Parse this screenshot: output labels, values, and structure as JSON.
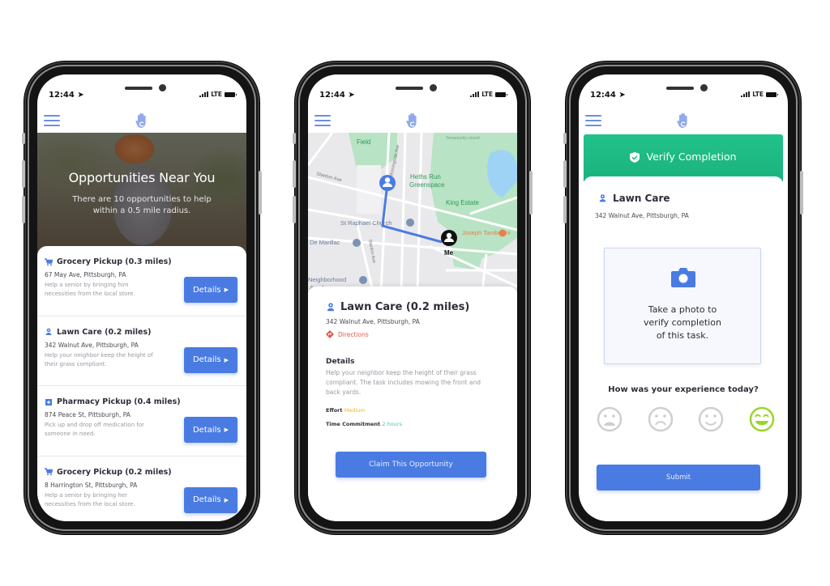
{
  "colors": {
    "primary": "#4a7be3",
    "green": "#1ebb84",
    "directions": "#e25a4a",
    "effort": "#f2b824",
    "time": "#3ec9b0",
    "happy_face": "#9ad52b"
  },
  "status_bar": {
    "time": "12:44",
    "location_icon": "location-arrow-icon",
    "network": "LTE"
  },
  "phone1": {
    "hero": {
      "title": "Opportunities Near You",
      "subtitle": "There are 10 opportunities to help within a 0.5 mile radius."
    },
    "items": [
      {
        "icon": "cart-icon",
        "title": "Grocery Pickup (0.3 miles)",
        "address": "67 May Ave, Pittsburgh, PA",
        "description": "Help a senior by bringing him necessities from the local store.",
        "button": "Details"
      },
      {
        "icon": "person-pin-icon",
        "title": "Lawn Care (0.2 miles)",
        "address": "342 Walnut Ave, Pittsburgh, PA",
        "description": "Help your neighbor keep the height of their grass compliant.",
        "button": "Details"
      },
      {
        "icon": "pharmacy-icon",
        "title": "Pharmacy Pickup (0.4 miles)",
        "address": "874 Peace St, Pittsburgh, PA",
        "description": "Pick up and drop off medication for someone in need.",
        "button": "Details"
      },
      {
        "icon": "cart-icon",
        "title": "Grocery Pickup (0.2 miles)",
        "address": "8 Harrington St, Pittsburgh, PA",
        "description": "Help a senior by bringing her necessities from the local store.",
        "button": "Details"
      }
    ]
  },
  "phone2": {
    "map": {
      "labels": {
        "field": "Field",
        "stanton": "Stanton Ave",
        "morningside": "Morningside Ave",
        "heths_run": "Heths Run",
        "greenspace": "Greenspace",
        "king_estate": "King Estate",
        "st_raphael": "St Raphael Church",
        "de_marillac": "De Marillac",
        "stanton2": "Stanton Ave",
        "tambellini": "Joseph Tambellini",
        "neighborhood": "Neighborhood",
        "academy": "Academy",
        "temporarily_closed": "Temporarily closed",
        "me": "Me"
      }
    },
    "title": "Lawn Care (0.2 miles)",
    "address": "342 Walnut Ave, Pittsburgh, PA",
    "directions": "Directions",
    "details_heading": "Details",
    "details_text": "Help your neighbor keep the height of their grass compliant. The task includes mowing the front and back yards.",
    "effort_label": "Effort",
    "effort_value": "Medium",
    "time_label": "Time Commitment",
    "time_value": "2 hours",
    "claim_button": "Claim This Opportunity"
  },
  "phone3": {
    "header": "Verify Completion",
    "title": "Lawn Care",
    "address": "342 Walnut Ave, Pittsburgh, PA",
    "photo_prompt_lines": [
      "Take a photo to",
      "verify completion",
      "of this task."
    ],
    "question": "How was your experience today?",
    "ratings": [
      "very-sad",
      "sad",
      "happy",
      "very-happy"
    ],
    "selected_rating": "very-happy",
    "submit": "Submit"
  }
}
